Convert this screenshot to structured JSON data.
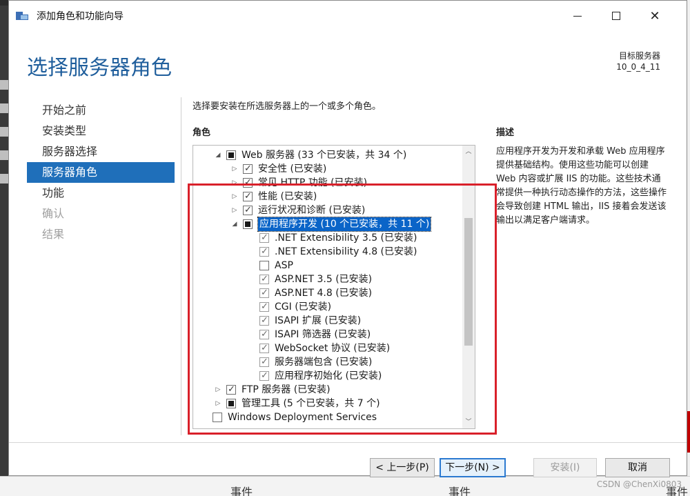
{
  "window": {
    "title": "添加角色和功能向导",
    "page_title": "选择服务器角色",
    "target_label": "目标服务器",
    "target_value": "10_0_4_11"
  },
  "nav": {
    "items": [
      {
        "label": "开始之前",
        "state": "normal"
      },
      {
        "label": "安装类型",
        "state": "normal"
      },
      {
        "label": "服务器选择",
        "state": "normal"
      },
      {
        "label": "服务器角色",
        "state": "active"
      },
      {
        "label": "功能",
        "state": "normal"
      },
      {
        "label": "确认",
        "state": "disabled"
      },
      {
        "label": "结果",
        "state": "disabled"
      }
    ]
  },
  "main": {
    "instruction": "选择要安装在所选服务器上的一个或多个角色。",
    "roles_heading": "角色",
    "description_heading": "描述",
    "description_text": "应用程序开发为开发和承载 Web 应用程序提供基础结构。使用这些功能可以创建 Web 内容或扩展 IIS 的功能。这些技术通常提供一种执行动态操作的方法，这些操作会导致创建 HTML 输出，IIS 接着会发送该输出以满足客户端请求。"
  },
  "tree": {
    "rows": [
      {
        "label": "Web 服务器 (33 个已安装，共 34 个)",
        "level": 1,
        "expander": "expanded",
        "check": "partial"
      },
      {
        "label": "安全性 (已安装)",
        "level": 2,
        "expander": "collapsed",
        "check": "checked"
      },
      {
        "label": "常见 HTTP 功能 (已安装)",
        "level": 2,
        "expander": "collapsed",
        "check": "checked"
      },
      {
        "label": "性能 (已安装)",
        "level": 2,
        "expander": "collapsed",
        "check": "checked"
      },
      {
        "label": "运行状况和诊断 (已安装)",
        "level": 2,
        "expander": "collapsed",
        "check": "checked"
      },
      {
        "label": "应用程序开发 (10 个已安装，共 11 个)",
        "level": 2,
        "expander": "expanded",
        "check": "partial",
        "selected": true
      },
      {
        "label": ".NET Extensibility 3.5 (已安装)",
        "level": 3,
        "expander": "none",
        "check": "checked-grey"
      },
      {
        "label": ".NET Extensibility 4.8 (已安装)",
        "level": 3,
        "expander": "none",
        "check": "checked-grey"
      },
      {
        "label": "ASP",
        "level": 3,
        "expander": "none",
        "check": "unchecked"
      },
      {
        "label": "ASP.NET 3.5 (已安装)",
        "level": 3,
        "expander": "none",
        "check": "checked-grey"
      },
      {
        "label": "ASP.NET 4.8 (已安装)",
        "level": 3,
        "expander": "none",
        "check": "checked-grey"
      },
      {
        "label": "CGI (已安装)",
        "level": 3,
        "expander": "none",
        "check": "checked-grey"
      },
      {
        "label": "ISAPI 扩展 (已安装)",
        "level": 3,
        "expander": "none",
        "check": "checked-grey"
      },
      {
        "label": "ISAPI 筛选器 (已安装)",
        "level": 3,
        "expander": "none",
        "check": "checked-grey"
      },
      {
        "label": "WebSocket 协议 (已安装)",
        "level": 3,
        "expander": "none",
        "check": "checked-grey"
      },
      {
        "label": "服务器端包含 (已安装)",
        "level": 3,
        "expander": "none",
        "check": "checked-grey"
      },
      {
        "label": "应用程序初始化 (已安装)",
        "level": 3,
        "expander": "none",
        "check": "checked-grey"
      },
      {
        "label": "FTP 服务器 (已安装)",
        "level": 1,
        "expander": "collapsed",
        "check": "checked"
      },
      {
        "label": "管理工具 (5 个已安装，共 7 个)",
        "level": 1,
        "expander": "collapsed",
        "check": "partial"
      },
      {
        "label": "Windows Deployment Services",
        "level": 0,
        "expander": "none",
        "check": "unchecked"
      }
    ]
  },
  "buttons": {
    "prev": "< 上一步(P)",
    "next": "下一步(N) >",
    "install": "安装(I)",
    "cancel": "取消"
  },
  "background": {
    "event_label_1": "事件",
    "event_label_2": "事件",
    "event_label_3": "事件",
    "watermark": "CSDN @ChenXi0803"
  },
  "colors": {
    "accent": "#1f6fba",
    "title_blue": "#1f5e9c",
    "highlight_red": "#d9202a"
  }
}
